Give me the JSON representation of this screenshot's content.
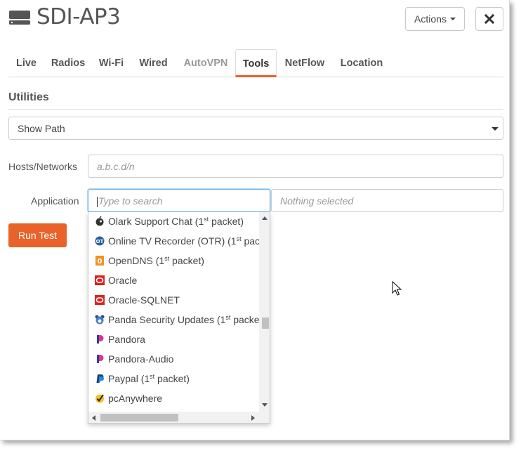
{
  "header": {
    "title": "SDI-AP3",
    "actions_label": "Actions",
    "icons": {
      "device": "device-icon",
      "close": "close-icon",
      "dropdown": "caret-down-icon"
    }
  },
  "tabs": [
    {
      "label": "Live",
      "state": "normal"
    },
    {
      "label": "Radios",
      "state": "normal"
    },
    {
      "label": "Wi-Fi",
      "state": "normal"
    },
    {
      "label": "Wired",
      "state": "normal"
    },
    {
      "label": "AutoVPN",
      "state": "disabled"
    },
    {
      "label": "Tools",
      "state": "active"
    },
    {
      "label": "NetFlow",
      "state": "normal"
    },
    {
      "label": "Location",
      "state": "normal"
    }
  ],
  "utilities": {
    "heading": "Utilities",
    "tool_select": "Show Path",
    "hosts_label": "Hosts/Networks",
    "hosts_placeholder": "a.b.c.d/n",
    "app_label": "Application",
    "app_search_placeholder": "Type to search",
    "app_selected_placeholder": "Nothing selected",
    "run_label": "Run Test"
  },
  "app_list": [
    {
      "label": "Olark Support Chat (1",
      "sup": "st",
      "rest": " packet)",
      "icon": "olark-icon"
    },
    {
      "label": "Online TV Recorder (OTR) (1",
      "sup": "st",
      "rest": " packet)",
      "icon": "otr-icon"
    },
    {
      "label": "OpenDNS (1",
      "sup": "st",
      "rest": " packet)",
      "icon": "opendns-icon"
    },
    {
      "label": "Oracle",
      "sup": "",
      "rest": "",
      "icon": "oracle-icon"
    },
    {
      "label": "Oracle-SQLNET",
      "sup": "",
      "rest": "",
      "icon": "oracle-icon"
    },
    {
      "label": "Panda Security Updates (1",
      "sup": "st",
      "rest": " packet)",
      "icon": "panda-icon"
    },
    {
      "label": "Pandora",
      "sup": "",
      "rest": "",
      "icon": "pandora-icon"
    },
    {
      "label": "Pandora-Audio",
      "sup": "",
      "rest": "",
      "icon": "pandora-icon"
    },
    {
      "label": "Paypal (1",
      "sup": "st",
      "rest": " packet)",
      "icon": "paypal-icon"
    },
    {
      "label": "pcAnywhere",
      "sup": "",
      "rest": "",
      "icon": "pcanywhere-icon"
    }
  ],
  "colors": {
    "accent": "#e8622a",
    "focus": "#66afe9"
  }
}
